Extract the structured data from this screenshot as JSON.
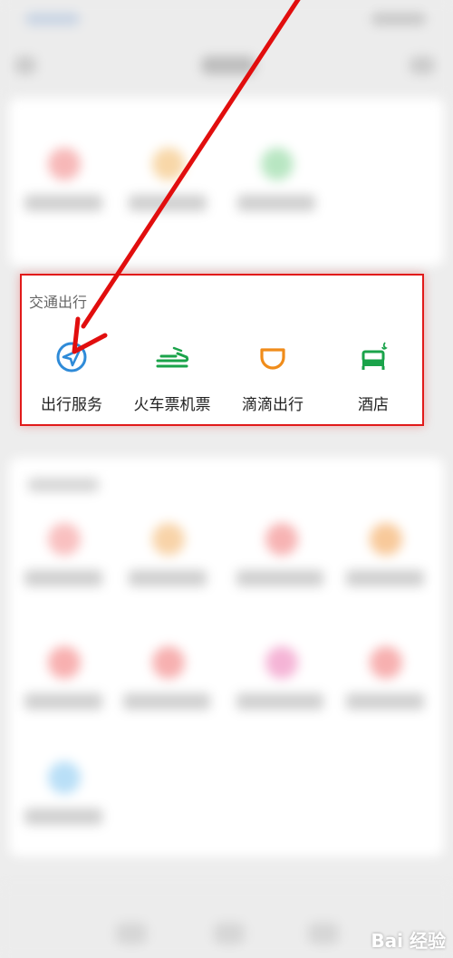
{
  "section": {
    "title": "交通出行",
    "items": [
      {
        "label": "出行服务",
        "icon": "navigation-arrow-icon",
        "color": "#2f8bd8"
      },
      {
        "label": "火车票机票",
        "icon": "train-icon",
        "color": "#1aa34a"
      },
      {
        "label": "滴滴出行",
        "icon": "didi-icon",
        "color": "#f08c1a"
      },
      {
        "label": "酒店",
        "icon": "bed-icon",
        "color": "#1aa34a"
      }
    ]
  },
  "colors": {
    "highlight_border": "#e11a1a",
    "arrow": "#e10e0e"
  },
  "watermark": "Bai 经验"
}
